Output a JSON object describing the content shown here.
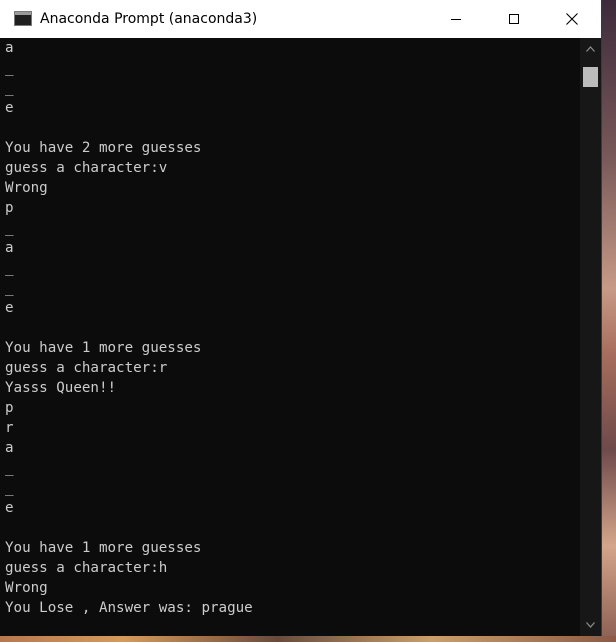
{
  "window": {
    "title": "Anaconda Prompt (anaconda3)",
    "icon": "console-app-icon"
  },
  "controls": {
    "minimize_icon": "minimize-icon",
    "maximize_icon": "maximize-icon",
    "close_icon": "close-icon"
  },
  "console": {
    "lines": [
      "a",
      "_",
      "_",
      "e",
      "",
      "You have 2 more guesses",
      "guess a character:v",
      "Wrong",
      "p",
      "_",
      "a",
      "_",
      "_",
      "e",
      "",
      "You have 1 more guesses",
      "guess a character:r",
      "Yasss Queen!!",
      "p",
      "r",
      "a",
      "_",
      "_",
      "e",
      "",
      "You have 1 more guesses",
      "guess a character:h",
      "Wrong",
      "You Lose , Answer was: prague"
    ]
  },
  "scrollbar": {
    "up_icon": "scroll-up-arrow-icon",
    "down_icon": "scroll-down-arrow-icon"
  },
  "colors": {
    "console_bg": "#0c0c0c",
    "console_text": "#cccccc",
    "titlebar_bg": "#ffffff"
  }
}
